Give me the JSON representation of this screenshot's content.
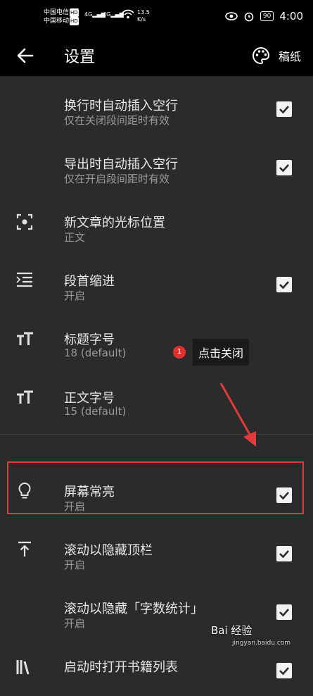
{
  "status": {
    "carrier1": "中国电信",
    "carrier2": "中国移动",
    "hd": "HD",
    "net1": "4G",
    "net2": "4G",
    "speed_val": "13.5",
    "speed_unit": "K/s",
    "battery": "90",
    "time": "4:00"
  },
  "appbar": {
    "title": "设置",
    "draft_label": "稿纸"
  },
  "settings": [
    {
      "title": "换行时自动插入空行",
      "subtitle": "仅在关闭段间距时有效",
      "icon": "",
      "checked": true
    },
    {
      "title": "导出时自动插入空行",
      "subtitle": "仅在开启段间距时有效",
      "icon": "",
      "checked": true
    },
    {
      "title": "新文章的光标位置",
      "subtitle": "正文",
      "icon": "cursor-focus-icon",
      "checked": null
    },
    {
      "title": "段首缩进",
      "subtitle": "开启",
      "icon": "indent-icon",
      "checked": true
    },
    {
      "title": "标题字号",
      "subtitle": "18 (default)",
      "icon": "text-size-icon",
      "checked": null
    },
    {
      "title": "正文字号",
      "subtitle": "15 (default)",
      "icon": "text-size-icon",
      "checked": null
    },
    {
      "title": "屏幕常亮",
      "subtitle": "开启",
      "icon": "lightbulb-icon",
      "checked": true
    },
    {
      "title": "滚动以隐藏顶栏",
      "subtitle": "开启",
      "icon": "scroll-top-icon",
      "checked": true
    },
    {
      "title": "滚动以隐藏「字数统计」",
      "subtitle": "开启",
      "icon": "",
      "checked": true
    },
    {
      "title": "启动时打开书籍列表",
      "subtitle": "",
      "icon": "books-icon",
      "checked": true
    }
  ],
  "annotation": {
    "badge_number": "1",
    "tip_text": "点击关闭",
    "highlight_color": "#e23a3a"
  },
  "watermark": {
    "brand": "Bai 经验",
    "url": "jingyan.baidu.com"
  }
}
